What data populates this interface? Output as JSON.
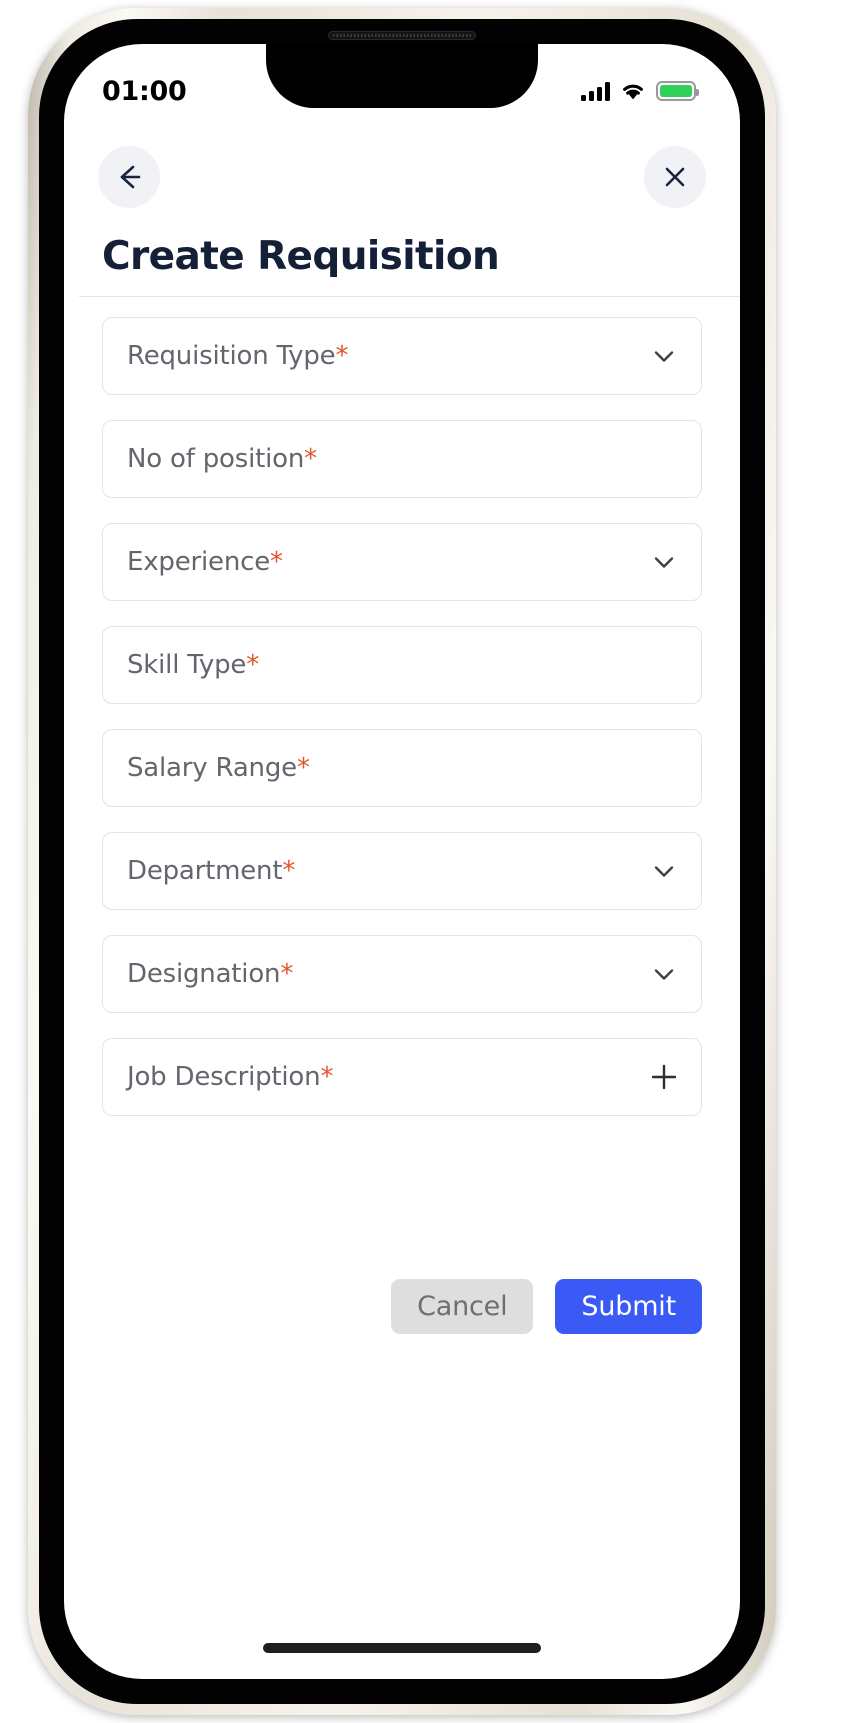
{
  "status_bar": {
    "time": "01:00",
    "signal_icon": "cellular-signal-icon",
    "wifi_icon": "wifi-icon",
    "battery_icon": "battery-full-icon",
    "battery_color": "#30d158"
  },
  "nav": {
    "back_icon": "arrow-left-icon",
    "close_icon": "close-x-icon"
  },
  "header": {
    "title": "Create Requisition",
    "title_color": "#141f38"
  },
  "form": {
    "required_marker": "*",
    "required_marker_color": "#e2562a",
    "fields": [
      {
        "label": "Requisition Type",
        "required": true,
        "icon": "chevron-down-icon",
        "type": "select",
        "value": "",
        "placeholder": "Requisition Type"
      },
      {
        "label": "No of position",
        "required": true,
        "icon": "none",
        "type": "text",
        "value": "",
        "placeholder": "No of position"
      },
      {
        "label": "Experience",
        "required": true,
        "icon": "chevron-down-icon",
        "type": "select",
        "value": "",
        "placeholder": "Experience"
      },
      {
        "label": "Skill Type",
        "required": true,
        "icon": "none",
        "type": "text",
        "value": "",
        "placeholder": "Skill Type"
      },
      {
        "label": "Salary Range",
        "required": true,
        "icon": "none",
        "type": "text",
        "value": "",
        "placeholder": "Salary Range"
      },
      {
        "label": "Department",
        "required": true,
        "icon": "chevron-down-icon",
        "type": "select",
        "value": "",
        "placeholder": "Department"
      },
      {
        "label": "Designation",
        "required": true,
        "icon": "chevron-down-icon",
        "type": "select",
        "value": "",
        "placeholder": "Designation"
      },
      {
        "label": "Job Description",
        "required": true,
        "icon": "plus-icon",
        "type": "expand",
        "value": "",
        "placeholder": "Job Description"
      }
    ]
  },
  "actions": {
    "cancel_label": "Cancel",
    "submit_label": "Submit",
    "cancel_color": "#dedede",
    "submit_color": "#3b59f5"
  }
}
